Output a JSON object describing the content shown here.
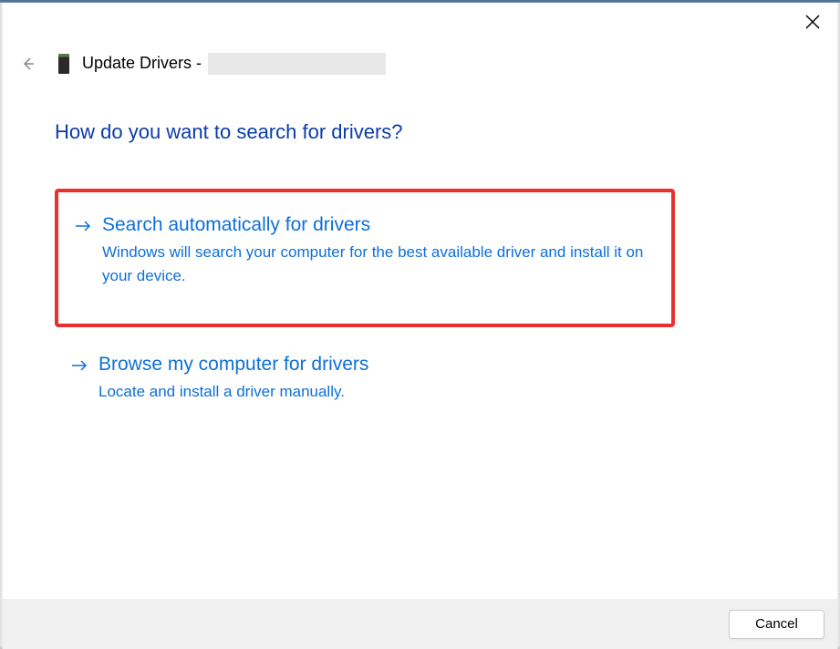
{
  "header": {
    "title_prefix": "Update Drivers -"
  },
  "heading": "How do you want to search for drivers?",
  "options": [
    {
      "title": "Search automatically for drivers",
      "description": "Windows will search your computer for the best available driver and install it on your device.",
      "highlighted": true
    },
    {
      "title": "Browse my computer for drivers",
      "description": "Locate and install a driver manually.",
      "highlighted": false
    }
  ],
  "footer": {
    "cancel_label": "Cancel"
  },
  "colors": {
    "heading_blue": "#0a3ca8",
    "link_blue": "#0e6fd8",
    "highlight_red": "#e83030"
  }
}
